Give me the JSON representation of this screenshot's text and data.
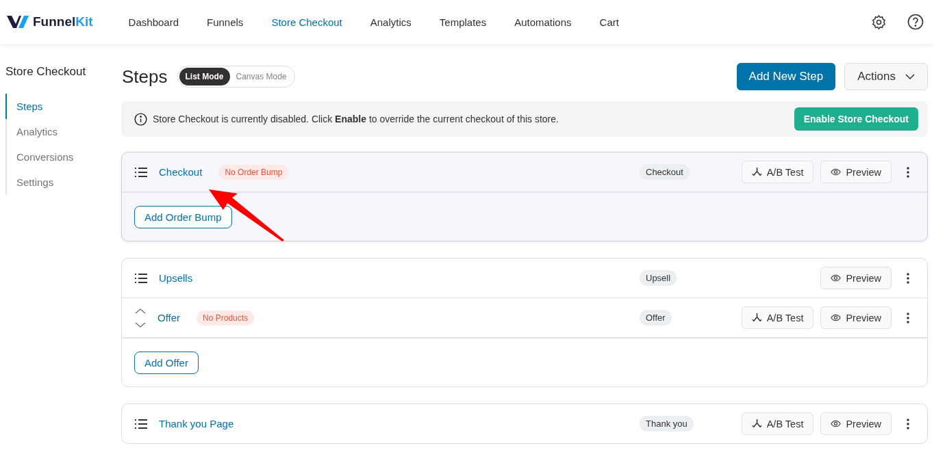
{
  "brand": {
    "name": "Funnel",
    "accent": "Kit"
  },
  "nav": [
    {
      "label": "Dashboard",
      "selected": false
    },
    {
      "label": "Funnels",
      "selected": false
    },
    {
      "label": "Store Checkout",
      "selected": true
    },
    {
      "label": "Analytics",
      "selected": false
    },
    {
      "label": "Templates",
      "selected": false
    },
    {
      "label": "Automations",
      "selected": false
    },
    {
      "label": "Cart",
      "selected": false
    }
  ],
  "sidebar": {
    "title": "Store Checkout",
    "items": [
      {
        "label": "Steps",
        "selected": true
      },
      {
        "label": "Analytics",
        "selected": false
      },
      {
        "label": "Conversions",
        "selected": false
      },
      {
        "label": "Settings",
        "selected": false
      }
    ]
  },
  "page": {
    "title": "Steps",
    "modes": [
      {
        "label": "List Mode",
        "selected": true
      },
      {
        "label": "Canvas Mode",
        "selected": false
      }
    ],
    "add_button": "Add New Step",
    "actions_button": "Actions"
  },
  "notice": {
    "text": "Store Checkout is currently disabled. Click **Enable** to override the current checkout of this store.",
    "button": "Enable Store Checkout"
  },
  "cards": [
    {
      "highlighted": true,
      "rows": [
        {
          "kind": "list",
          "title": "Checkout",
          "badge": "No Order Bump",
          "type": "Checkout",
          "ab_test": "A/B Test",
          "preview": "Preview"
        }
      ],
      "footer_button": "Add Order Bump"
    },
    {
      "highlighted": false,
      "rows": [
        {
          "kind": "list",
          "title": "Upsells",
          "type": "Upsell",
          "preview": "Preview"
        },
        {
          "kind": "arrows",
          "title": "Offer",
          "badge": "No Products",
          "type": "Offer",
          "ab_test": "A/B Test",
          "preview": "Preview"
        }
      ],
      "footer_button": "Add Offer"
    },
    {
      "highlighted": false,
      "rows": [
        {
          "kind": "list",
          "title": "Thank you Page",
          "type": "Thank you",
          "ab_test": "A/B Test",
          "preview": "Preview"
        }
      ]
    }
  ]
}
